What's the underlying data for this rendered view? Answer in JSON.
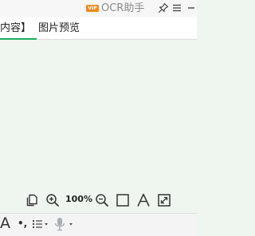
{
  "titlebar": {
    "vip_badge": "VIP",
    "app_title": "OCR助手",
    "icons": [
      "pin-icon",
      "menu-icon",
      "dropdown-icon"
    ]
  },
  "tabs": [
    {
      "label": "内容】",
      "active": true
    },
    {
      "label": "图片预览",
      "active": false
    }
  ],
  "image_toolbar": {
    "zoom_level": "100%",
    "icons": [
      "copy-icon",
      "zoom-in-icon",
      "zoom-out-icon",
      "fit-square-icon",
      "text-recognize-icon",
      "fullscreen-icon"
    ]
  },
  "bottom_toolbar": {
    "font_glyph": "A",
    "punct_glyph": "•,",
    "icons": [
      "list-format-icon",
      "microphone-icon"
    ]
  },
  "colors": {
    "accent": "#1aad5f",
    "vip": "#f28a17",
    "content_bg": "#eef6ef"
  }
}
